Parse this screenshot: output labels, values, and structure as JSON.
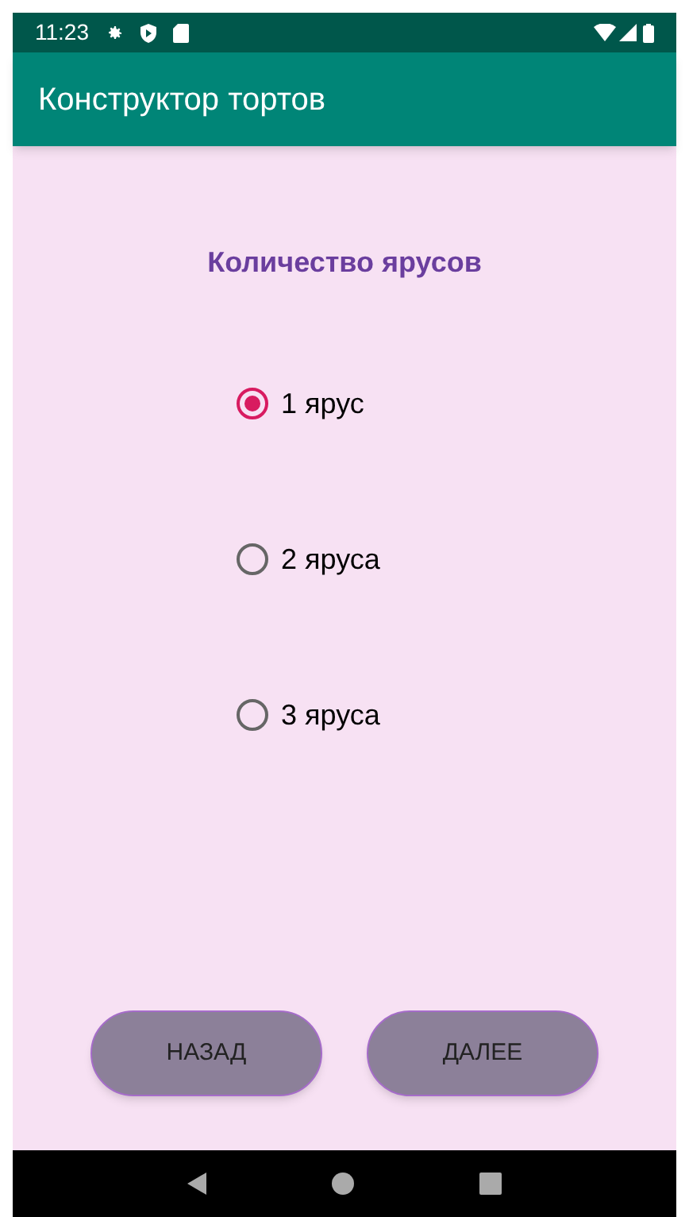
{
  "status_bar": {
    "time": "11:23"
  },
  "app_bar": {
    "title": "Конструктор тортов"
  },
  "heading": "Количество ярусов",
  "options": [
    {
      "label": "1 ярус",
      "selected": true
    },
    {
      "label": "2 яруса",
      "selected": false
    },
    {
      "label": "3 яруса",
      "selected": false
    }
  ],
  "buttons": [
    "НАЗАД",
    "ДАЛЕЕ"
  ]
}
